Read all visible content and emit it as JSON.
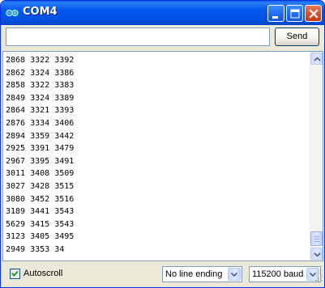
{
  "window": {
    "title": "COM4",
    "icon": "arduino-infinity-icon"
  },
  "titlebar_buttons": [
    "minimize-icon",
    "maximize-icon",
    "close-icon"
  ],
  "input": {
    "value": "",
    "placeholder": ""
  },
  "send_button": {
    "label": "Send"
  },
  "output": {
    "lines": [
      "2868 3322 3392",
      "2862 3324 3386",
      "2858 3322 3383",
      "2849 3324 3389",
      "2864 3321 3393",
      "2876 3334 3406",
      "2894 3359 3442",
      "2925 3391 3479",
      "2967 3395 3491",
      "3011 3408 3509",
      "3027 3428 3515",
      "3080 3452 3516",
      "3189 3441 3543",
      "5629 3415 3543",
      "3123 3405 3495",
      "2949 3353 34"
    ]
  },
  "footer": {
    "autoscroll_label": "Autoscroll",
    "autoscroll_checked": true,
    "line_ending": "No line ending",
    "baud_rate": "115200 baud"
  },
  "colors": {
    "titlebar": "#0058ee",
    "window_bg": "#ece9d8",
    "close_button": "#d9532f",
    "check_mark": "#21a121"
  }
}
